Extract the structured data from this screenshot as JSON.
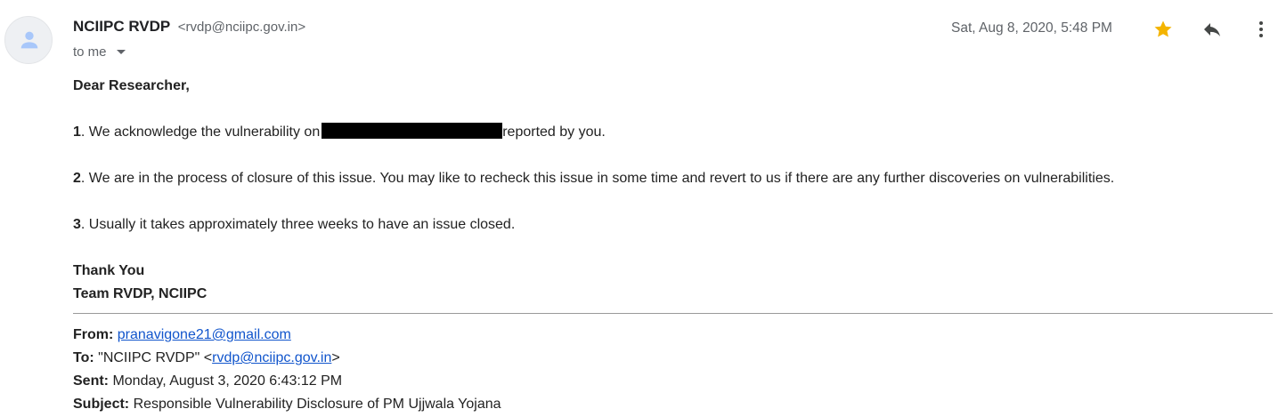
{
  "sender": {
    "name": "NCIIPC RVDP",
    "email": "<rvdp@nciipc.gov.in>",
    "recipient": "to me"
  },
  "date": "Sat, Aug 8, 2020, 5:48 PM",
  "icons": {
    "avatar": "person-icon",
    "star": "star-icon",
    "reply": "reply-icon",
    "more": "more-vert-icon",
    "caret": "chevron-down-icon"
  },
  "colors": {
    "star": "#f4b400",
    "link": "#1155cc",
    "meta_text": "#5f6368"
  },
  "message": {
    "greeting": "Dear Researcher,",
    "points": [
      {
        "num": "1",
        "before": ". We acknowledge the vulnerability on",
        "after": "reported by you."
      },
      {
        "num": "2",
        "text": ". We are in the process of closure of this issue. You may like to recheck this issue in some time and revert to us if there are any further discoveries on vulnerabilities."
      },
      {
        "num": "3",
        "text": ". Usually it takes approximately three weeks to have an issue closed."
      }
    ],
    "signoff": "Thank You",
    "team": "Team RVDP, NCIIPC"
  },
  "quoted": {
    "from_label": "From:",
    "from_value": "pranavigone21@gmail.com",
    "to_label": "To:",
    "to_name": "\"NCIIPC RVDP\" <",
    "to_email": "rvdp@nciipc.gov.in",
    "to_close": ">",
    "sent_label": "Sent:",
    "sent_value": "Monday, August 3, 2020 6:43:12 PM",
    "subject_label": "Subject:",
    "subject_value": "Responsible Vulnerability Disclosure of PM Ujjwala Yojana"
  }
}
